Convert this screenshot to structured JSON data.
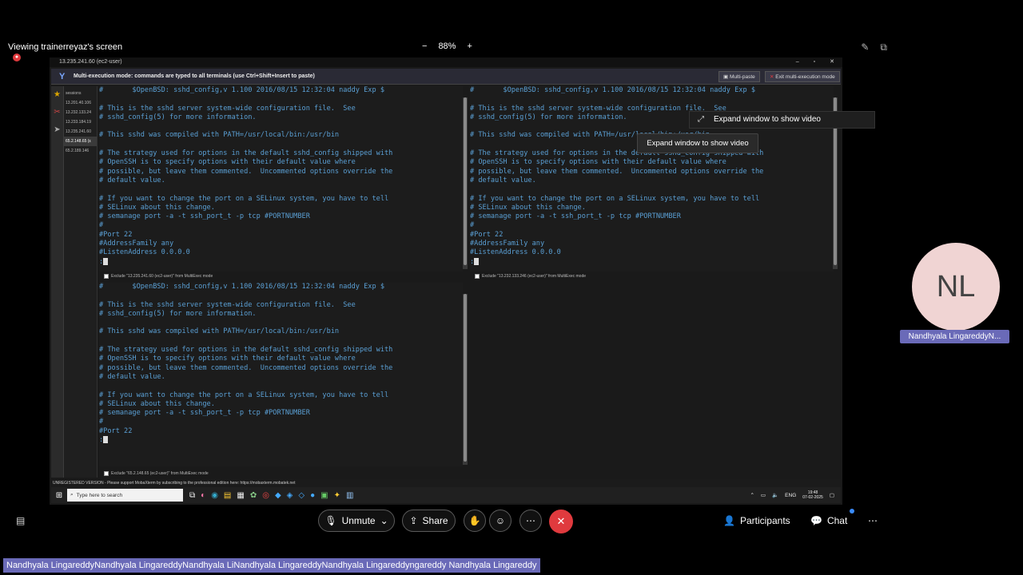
{
  "meeting": {
    "viewing_label": "Viewing trainerreyaz's screen",
    "zoom_minus": "−",
    "zoom_level": "88%",
    "zoom_plus": "+"
  },
  "screen": {
    "window_title": "13.235.241.60 (ec2-user)",
    "banner_text": "Multi-execution mode: commands are typed to all terminals (use Ctrl+Shift+Insert to paste)",
    "multi_paste": "Multi-paste",
    "exit_multi": "Exit multi-execution mode",
    "sessions": [
      "sessions",
      "13.201.40.106",
      "13.232.133.24",
      "13.233.184.19",
      "13.235.241.60",
      "65.2.148.65 (ε",
      "65.2.189.146"
    ],
    "term1": {
      "lines": [
        "#       $OpenBSD: sshd_config,v 1.100 2016/08/15 12:32:04 naddy Exp $",
        "",
        "# This is the sshd server system-wide configuration file.  See",
        "# sshd_config(5) for more information.",
        "",
        "# This sshd was compiled with PATH=/usr/local/bin:/usr/bin",
        "",
        "# The strategy used for options in the default sshd_config shipped with",
        "# OpenSSH is to specify options with their default value where",
        "# possible, but leave them commented.  Uncommented options override the",
        "# default value.",
        "",
        "# If you want to change the port on a SELinux system, you have to tell",
        "# SELinux about this change.",
        "# semanage port -a -t ssh_port_t -p tcp #PORTNUMBER",
        "#",
        "#Port 22",
        "#AddressFamily any",
        "#ListenAddress 0.0.0.0"
      ],
      "exclude": "Exclude \"13.235.241.60 (ec2-user)\" from MultiExec mode"
    },
    "term2": {
      "lines": [
        "#       $OpenBSD: sshd_config,v 1.100 2016/08/15 12:32:04 naddy Exp $",
        "",
        "# This is the sshd server system-wide configuration file.  See",
        "# sshd_config(5) for more information.",
        "",
        "# This sshd was compiled with PATH=/usr/local/bin:/usr/bin",
        "",
        "# The strategy used for options in the default sshd_config shipped with",
        "# OpenSSH is to specify options with their default value where",
        "# possible, but leave them commented.  Uncommented options override the",
        "# default value.",
        "",
        "# If you want to change the port on a SELinux system, you have to tell",
        "# SELinux about this change.",
        "# semanage port -a -t ssh_port_t -p tcp #PORTNUMBER",
        "#",
        "#Port 22",
        "#AddressFamily any",
        "#ListenAddress 0.0.0.0"
      ],
      "exclude": "Exclude \"13.232.133.246 (ec2-user)\" from MultiExec mode"
    },
    "term3": {
      "lines": [
        "#       $OpenBSD: sshd_config,v 1.100 2016/08/15 12:32:04 naddy Exp $",
        "",
        "# This is the sshd server system-wide configuration file.  See",
        "# sshd_config(5) for more information.",
        "",
        "# This sshd was compiled with PATH=/usr/local/bin:/usr/bin",
        "",
        "# The strategy used for options in the default sshd_config shipped with",
        "# OpenSSH is to specify options with their default value where",
        "# possible, but leave them commented.  Uncommented options override the",
        "# default value.",
        "",
        "# If you want to change the port on a SELinux system, you have to tell",
        "# SELinux about this change.",
        "# semanage port -a -t ssh_port_t -p tcp #PORTNUMBER",
        "#",
        "#Port 22"
      ],
      "exclude": "Exclude \"65.2.148.65 (ec2-user)\" from MultiExec mode"
    },
    "unregistered": "UNREGISTERED VERSION  -  Please support MobaXterm by subscribing to the professional edition here:  https://mobaxterm.mobatek.net",
    "taskbar": {
      "search_placeholder": "Type here to search",
      "lang": "ENG",
      "time": "19:48",
      "date": "07-02-2025"
    }
  },
  "tooltips": {
    "expand_primary": "Expand window to show video",
    "expand_secondary": "Expand window to show video"
  },
  "participant": {
    "initials": "NL",
    "name": "Nandhyala LingareddyN..."
  },
  "controls": {
    "unmute": "Unmute",
    "share": "Share",
    "participants": "Participants",
    "chat": "Chat"
  },
  "caption": "Nandhyala LingareddyNandhyala LingareddyNandhyala LiNandhyala LingareddyNandhyala Lingareddyngareddy Nandhyala Lingareddy",
  "colors": {
    "terminal_text": "#5a9fd4",
    "accent_red": "#e03a3e",
    "name_tag": "#6a6ab8",
    "avatar_bg": "#f0d4d3"
  }
}
